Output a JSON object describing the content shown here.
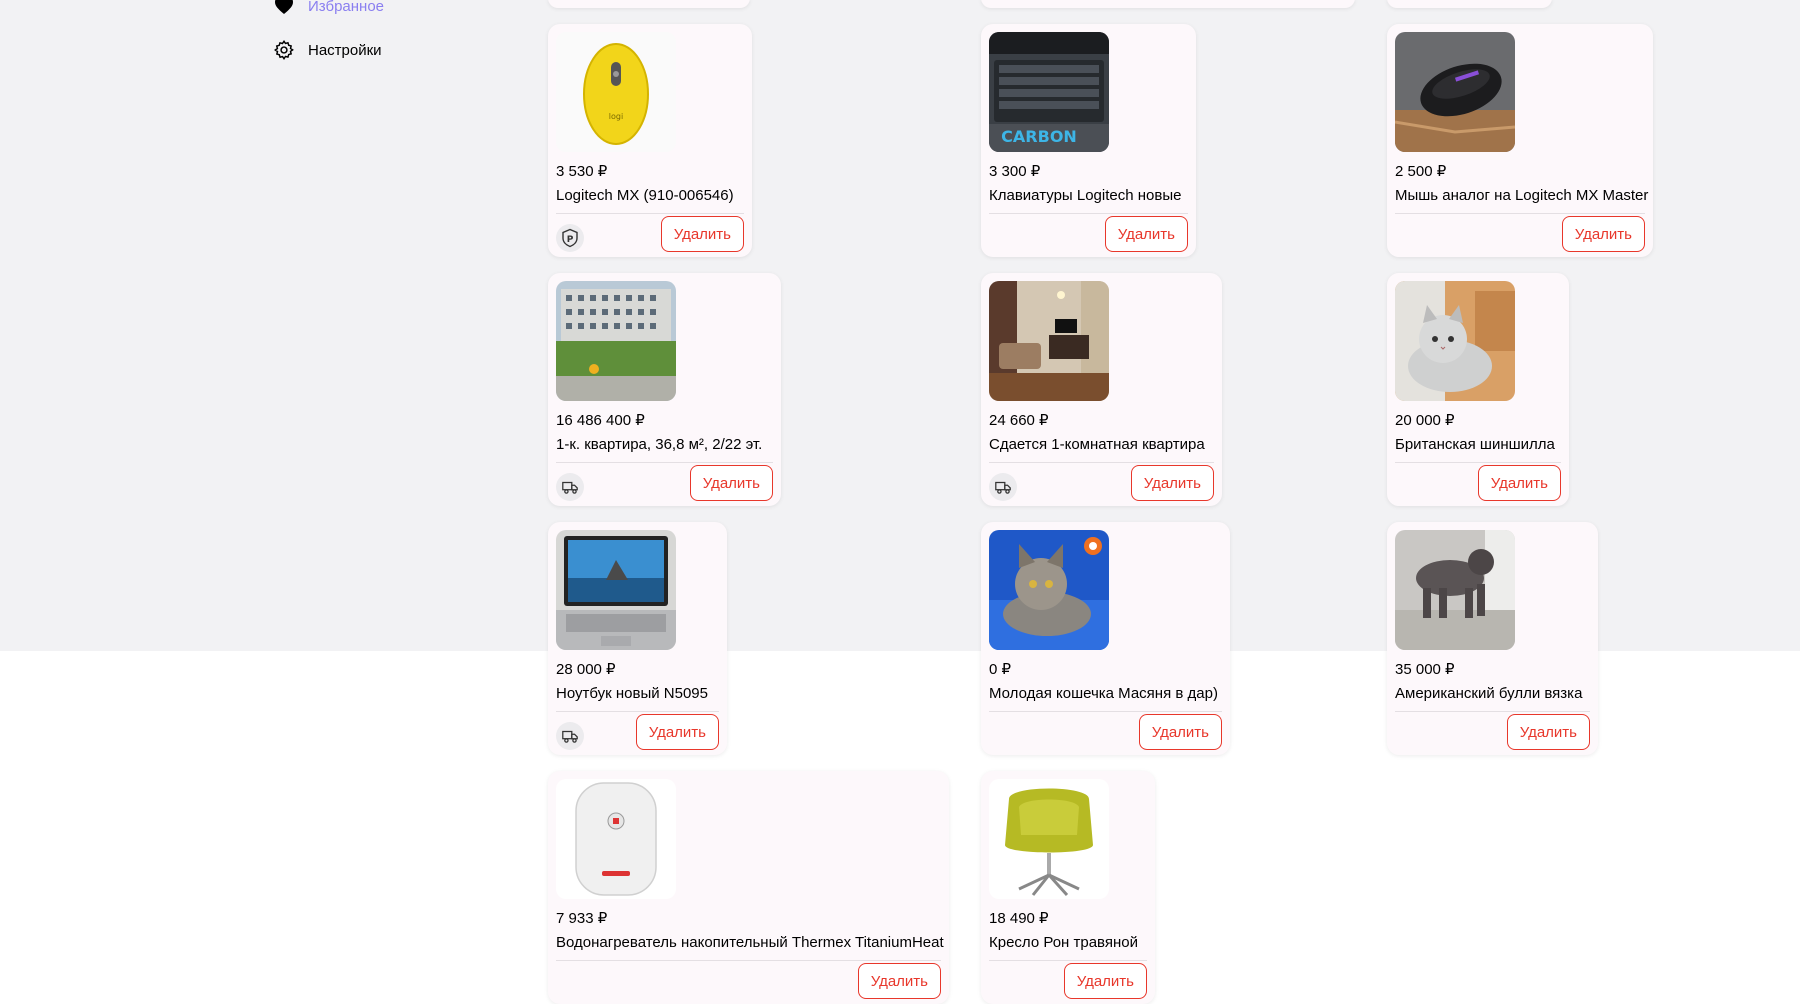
{
  "sidebar": {
    "favorites_label": "Избранное",
    "settings_label": "Настройки"
  },
  "colors": {
    "accent": "#e8372b",
    "favorites": "#8a7ff0",
    "card_bg": "#fdf8fb"
  },
  "delete_label": "Удалить",
  "items": [
    {
      "price": "3 530 ₽",
      "title": "Logitech MX (910-006546)",
      "badge": "p-icon",
      "thumb": "yellow-mouse"
    },
    {
      "price": "3 300 ₽",
      "title": "Клавиатуры Logitech новые",
      "badge": "",
      "thumb": "keyboard"
    },
    {
      "price": "2 500 ₽",
      "title": "Мышь аналог на Logitech MX Master",
      "badge": "",
      "thumb": "black-mouse"
    },
    {
      "price": "16 486 400 ₽",
      "title": "1-к. квартира, 36,8 м², 2/22 эт.",
      "badge": "truck-icon",
      "thumb": "building"
    },
    {
      "price": "24 660 ₽",
      "title": "Сдается 1-комнатная квартира",
      "badge": "truck-icon",
      "thumb": "room"
    },
    {
      "price": "20 000 ₽",
      "title": "Британская шиншилла",
      "badge": "",
      "thumb": "grey-cat"
    },
    {
      "price": "28 000 ₽",
      "title": "Ноутбук новый N5095",
      "badge": "truck-icon",
      "thumb": "laptop"
    },
    {
      "price": "0 ₽",
      "title": "Молодая кошечка Масяня в дар)",
      "badge": "",
      "thumb": "cat-blue"
    },
    {
      "price": "35 000 ₽",
      "title": "Американский булли вязка",
      "badge": "",
      "thumb": "dog"
    },
    {
      "price": "7 933 ₽",
      "title": "Водонагреватель накопительный Thermex TitaniumHeat",
      "badge": "",
      "thumb": "boiler"
    },
    {
      "price": "18 490 ₽",
      "title": "Кресло Рон травяной",
      "badge": "",
      "thumb": "chair"
    }
  ]
}
